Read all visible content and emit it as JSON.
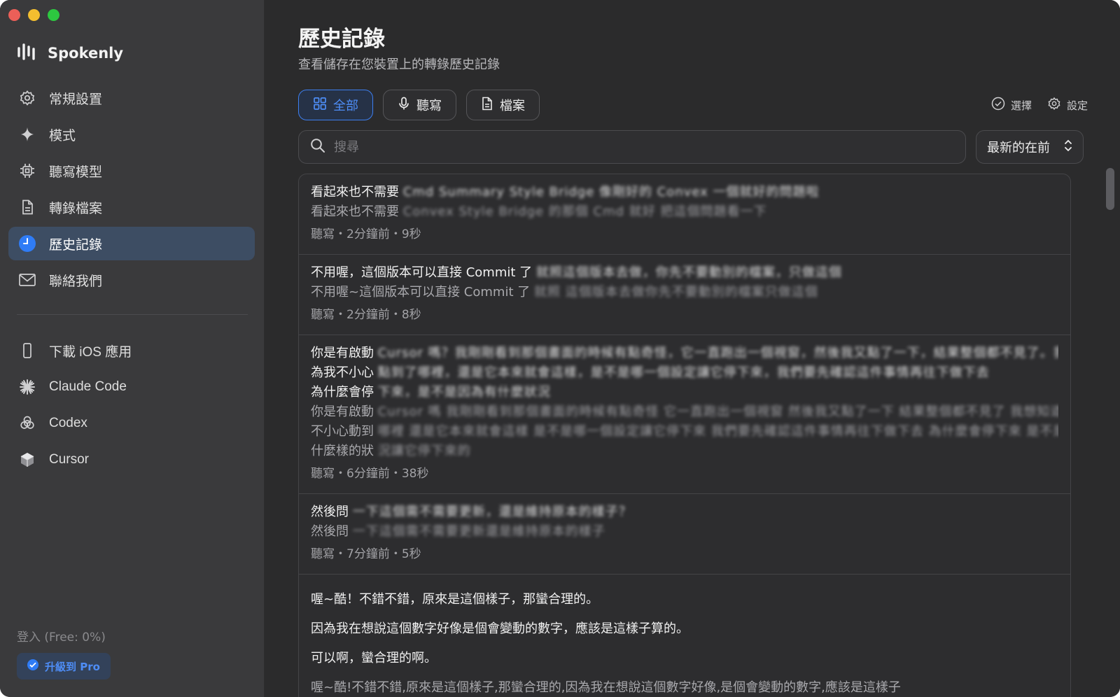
{
  "app": {
    "name": "Spokenly"
  },
  "sidebar": {
    "items": [
      {
        "label": "常規設置",
        "icon": "gear-icon"
      },
      {
        "label": "模式",
        "icon": "sparkle-icon"
      },
      {
        "label": "聽寫模型",
        "icon": "chip-icon"
      },
      {
        "label": "轉錄檔案",
        "icon": "document-icon"
      },
      {
        "label": "歷史記錄",
        "icon": "clock-icon",
        "active": true
      },
      {
        "label": "聯絡我們",
        "icon": "envelope-icon"
      }
    ],
    "integrations": [
      {
        "label": "下載 iOS 應用",
        "icon": "phone-icon"
      },
      {
        "label": "Claude Code",
        "icon": "claude-icon"
      },
      {
        "label": "Codex",
        "icon": "openai-icon"
      },
      {
        "label": "Cursor",
        "icon": "cursor-icon"
      }
    ],
    "login_label": "登入 (Free: 0%)",
    "upgrade_label": "升級到 Pro"
  },
  "header": {
    "title": "歷史記錄",
    "subtitle": "查看儲存在您裝置上的轉錄歷史記錄"
  },
  "filters": {
    "all": "全部",
    "dictation": "聽寫",
    "files": "檔案",
    "active": "all"
  },
  "actions": {
    "select": "選擇",
    "settings": "設定"
  },
  "search": {
    "placeholder": "搜尋",
    "value": ""
  },
  "sort": {
    "selected": "最新的在前"
  },
  "entries": [
    {
      "title_prefix": "看起來也不需要",
      "title_blur": "Cmd Summary Style Bridge 像剛好的 Convex 一個就好的問題啦",
      "body_prefix": "看起來也不需要",
      "body_blur": "Convex Style Bridge 的那個 Cmd 就好 把這個問題看一下",
      "meta": "聽寫・2分鐘前・9秒"
    },
    {
      "title_prefix": "不用喔，這個版本可以直接 Commit 了",
      "title_blur": "就照這個版本去做，你先不要動別的檔案，只做這個",
      "body_prefix": "不用喔~這個版本可以直接 Commit 了",
      "body_blur": "就照 這個版本去做你先不要動別的檔案只做這個",
      "meta": "聽寫・2分鐘前・8秒"
    },
    {
      "lines": [
        {
          "prefix": "你是有啟動",
          "blur": "Cursor 嗎？我剛剛看到那個畫面的時候有點奇怪，它一直跑出一個視窗，然後我又點了一下，結果整個都不見了。我想知道"
        },
        {
          "prefix": "為我不小心",
          "blur": "點到了哪裡，還是它本來就會這樣，是不是哪一個設定讓它停下來，我們要先確認這件事情再往下做下去"
        },
        {
          "prefix": "為什麼會停",
          "blur": "下來，是不是因為有什麼狀況"
        }
      ],
      "body_lines": [
        {
          "prefix": "你是有啟動",
          "blur": "Cursor 嗎 我剛剛看到那個畫面的時候有點奇怪 它一直跑出一個視窗 然後我又點了一下 結果整個都不見了 我想知道是不是因"
        },
        {
          "prefix": "不小心動到",
          "blur": "哪裡 還是它本來就會這樣 是不是哪一個設定讓它停下來 我們要先確認這件事情再往下做下去 為什麼會停下來 是不是有"
        },
        {
          "prefix": "什麼樣的狀",
          "blur": "況讓它停下來的"
        }
      ],
      "meta": "聽寫・6分鐘前・38秒"
    },
    {
      "title_prefix": "然後問",
      "title_blur": "一下這個需不需要更新，還是維持原本的樣子？",
      "body_prefix": "然後問",
      "body_blur": "一下這個需不需要更新還是維持原本的樣子",
      "meta": "聽寫・7分鐘前・5秒"
    }
  ],
  "open_entry": {
    "paragraphs": [
      "喔~酷！不錯不錯，原來是這個樣子，那蠻合理的。",
      "因為我在想說這個數字好像是個會變動的數字，應該是這樣子算的。",
      "可以啊，蠻合理的啊。"
    ],
    "body": "喔~酷!不錯不錯,原來是這個樣子,那蠻合理的,因為我在想說這個數字好像,是個會變動的數字,應該是這樣子"
  },
  "colors": {
    "accent": "#3d7ff0",
    "sidebar_bg": "#3a3a3c",
    "main_bg": "#2b2b2c"
  }
}
